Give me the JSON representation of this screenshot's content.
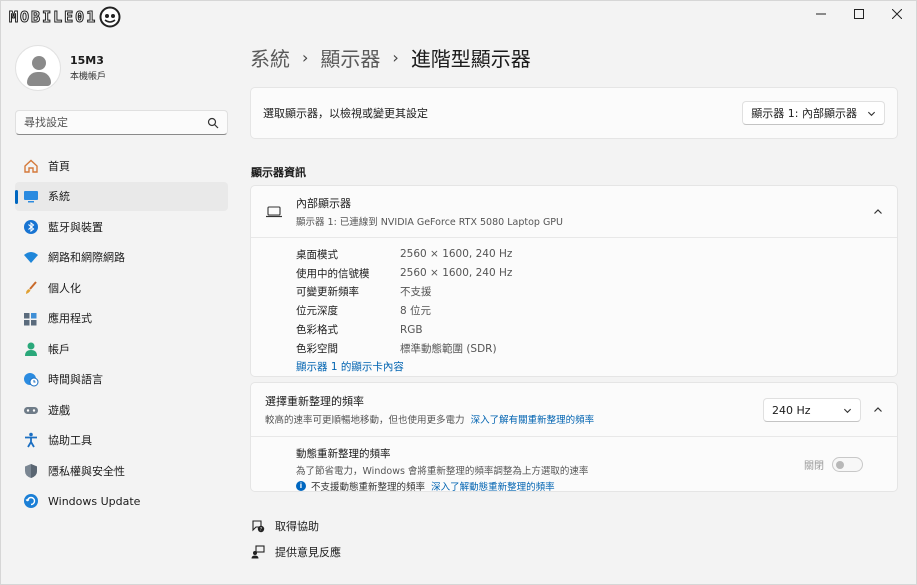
{
  "logo": {
    "text": "MOBILE01",
    "badge_icon": "mobile01-badge-icon"
  },
  "window_controls": {
    "minimize": "minimize-icon",
    "maximize": "maximize-icon",
    "close": "close-icon"
  },
  "profile": {
    "name": "15M3",
    "subtitle": "本機帳戶"
  },
  "search": {
    "placeholder": "尋找設定"
  },
  "nav": {
    "items": [
      {
        "label": "首頁",
        "icon": "home-icon"
      },
      {
        "label": "系統",
        "icon": "monitor-icon",
        "active": true
      },
      {
        "label": "藍牙與裝置",
        "icon": "bluetooth-icon"
      },
      {
        "label": "網路和網際網路",
        "icon": "wifi-icon"
      },
      {
        "label": "個人化",
        "icon": "brush-icon"
      },
      {
        "label": "應用程式",
        "icon": "apps-icon"
      },
      {
        "label": "帳戶",
        "icon": "account-icon"
      },
      {
        "label": "時間與語言",
        "icon": "globe-clock-icon"
      },
      {
        "label": "遊戲",
        "icon": "gamepad-icon"
      },
      {
        "label": "協助工具",
        "icon": "accessibility-icon"
      },
      {
        "label": "隱私權與安全性",
        "icon": "shield-icon"
      },
      {
        "label": "Windows Update",
        "icon": "update-icon"
      }
    ]
  },
  "breadcrumb": {
    "part1": "系統",
    "part2": "顯示器",
    "current": "進階型顯示器"
  },
  "select_display": {
    "label": "選取顯示器，以檢視或變更其設定",
    "selected": "顯示器 1: 內部顯示器"
  },
  "display_info": {
    "section_title": "顯示器資訊",
    "title": "內部顯示器",
    "subtitle": "顯示器 1: 已連線到 NVIDIA GeForce RTX 5080 Laptop GPU",
    "specs": [
      {
        "key": "桌面模式",
        "value": "2560 × 1600, 240 Hz"
      },
      {
        "key": "使用中的信號模",
        "value": "2560 × 1600, 240 Hz"
      },
      {
        "key": "可變更新頻率",
        "value": "不支援"
      },
      {
        "key": "位元深度",
        "value": "8 位元"
      },
      {
        "key": "色彩格式",
        "value": "RGB"
      },
      {
        "key": "色彩空間",
        "value": "標準動態範圍 (SDR)"
      }
    ],
    "adapter_link": "顯示器 1 的顯示卡內容"
  },
  "refresh": {
    "title": "選擇重新整理的頻率",
    "subtitle": "較高的速率可更順暢地移動，但也使用更多電力",
    "subtitle_link": "深入了解有關重新整理的頻率",
    "selected": "240 Hz",
    "dynamic_title": "動態重新整理的頻率",
    "dynamic_sub": "為了節省電力，Windows 會將重新整理的頻率調整為上方選取的速率",
    "dynamic_info": "不支援動態重新整理的頻率",
    "dynamic_link": "深入了解動態重新整理的頻率",
    "toggle_label": "關閉",
    "toggle_on": false
  },
  "help": {
    "get_help": "取得協助",
    "feedback": "提供意見反應"
  }
}
